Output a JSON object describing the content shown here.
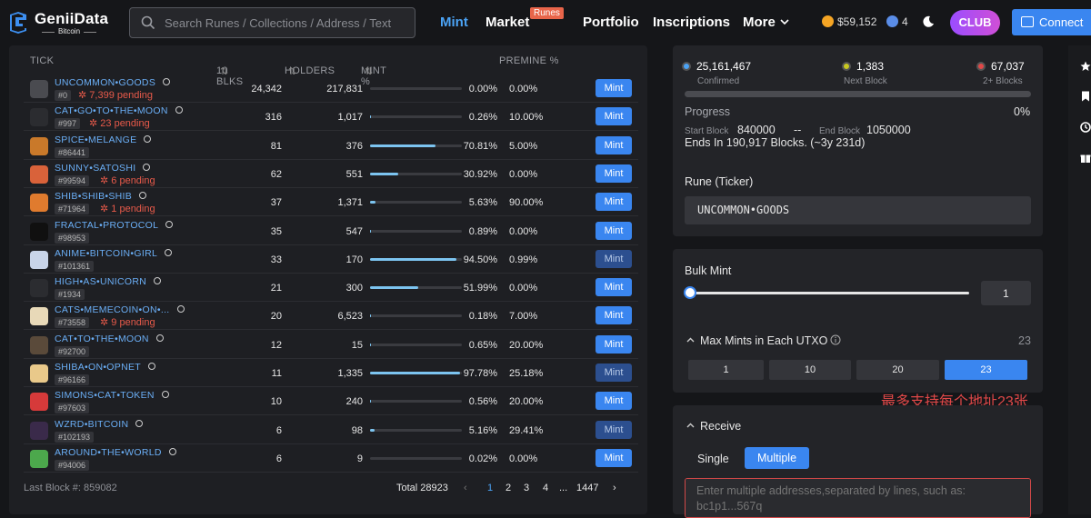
{
  "brand": {
    "name": "GeniiData",
    "subtitle": "Bitcoin"
  },
  "search": {
    "placeholder": "Search Runes / Collections / Address / Text"
  },
  "nav": {
    "mint": "Mint",
    "market": "Market",
    "market_badge": "Runes",
    "portfolio": "Portfolio",
    "inscriptions": "Inscriptions",
    "more": "More"
  },
  "header": {
    "btc_price": "$59,152",
    "gas": "4",
    "club": "CLUB",
    "connect": "Connect"
  },
  "table": {
    "headers": {
      "tick": "TICK",
      "blks": "10 BLKS",
      "holders": "HOLDERS",
      "mint": "MINT %",
      "premine": "PREMINE %"
    },
    "mint_label": "Mint",
    "rows": [
      {
        "tick": "UNCOMMON•GOODS",
        "num": "#0",
        "pending": "7,399 pending",
        "blks": "24,342",
        "holders": "217,831",
        "mint_pct": "0.00%",
        "progress": 0.0,
        "premine": "0.00%",
        "icon_color": "#4a4b50",
        "dim": false
      },
      {
        "tick": "CAT•GO•TO•THE•MOON",
        "num": "#997",
        "pending": "23 pending",
        "blks": "316",
        "holders": "1,017",
        "mint_pct": "0.26%",
        "progress": 0.26,
        "premine": "10.00%",
        "icon_color": "#2b2c30",
        "dim": false
      },
      {
        "tick": "SPICE•MELANGE",
        "num": "#86441",
        "pending": "",
        "blks": "81",
        "holders": "376",
        "mint_pct": "70.81%",
        "progress": 70.81,
        "premine": "5.00%",
        "icon_color": "#c9792a",
        "dim": false
      },
      {
        "tick": "SUNNY•SATOSHI",
        "num": "#99594",
        "pending": "6 pending",
        "blks": "62",
        "holders": "551",
        "mint_pct": "30.92%",
        "progress": 30.92,
        "premine": "0.00%",
        "icon_color": "#d9623a",
        "dim": false
      },
      {
        "tick": "SHIB•SHIB•SHIB",
        "num": "#71964",
        "pending": "1 pending",
        "blks": "37",
        "holders": "1,371",
        "mint_pct": "5.63%",
        "progress": 5.63,
        "premine": "90.00%",
        "icon_color": "#e07b2e",
        "dim": false
      },
      {
        "tick": "FRACTAL•PROTOCOL",
        "num": "#98953",
        "pending": "",
        "blks": "35",
        "holders": "547",
        "mint_pct": "0.89%",
        "progress": 0.89,
        "premine": "0.00%",
        "icon_color": "#101010",
        "dim": false
      },
      {
        "tick": "ANIME•BITCOIN•GIRL",
        "num": "#101361",
        "pending": "",
        "blks": "33",
        "holders": "170",
        "mint_pct": "94.50%",
        "progress": 94.5,
        "premine": "0.99%",
        "icon_color": "#c8d4e8",
        "dim": true
      },
      {
        "tick": "HIGH•AS•UNICORN",
        "num": "#1934",
        "pending": "",
        "blks": "21",
        "holders": "300",
        "mint_pct": "51.99%",
        "progress": 51.99,
        "premine": "0.00%",
        "icon_color": "#2b2c30",
        "dim": false
      },
      {
        "tick": "CATS•MEMECOIN•ON•...",
        "num": "#73558",
        "pending": "9 pending",
        "blks": "20",
        "holders": "6,523",
        "mint_pct": "0.18%",
        "progress": 0.18,
        "premine": "7.00%",
        "icon_color": "#e8d9b8",
        "dim": false
      },
      {
        "tick": "CAT•TO•THE•MOON",
        "num": "#92700",
        "pending": "",
        "blks": "12",
        "holders": "15",
        "mint_pct": "0.65%",
        "progress": 0.65,
        "premine": "20.00%",
        "icon_color": "#5a4a3a",
        "dim": false
      },
      {
        "tick": "SHIBA•ON•OPNET",
        "num": "#96166",
        "pending": "",
        "blks": "11",
        "holders": "1,335",
        "mint_pct": "97.78%",
        "progress": 97.78,
        "premine": "25.18%",
        "icon_color": "#e9c98a",
        "dim": true
      },
      {
        "tick": "SIMONS•CAT•TOKEN",
        "num": "#97603",
        "pending": "",
        "blks": "10",
        "holders": "240",
        "mint_pct": "0.56%",
        "progress": 0.56,
        "premine": "20.00%",
        "icon_color": "#d63a3a",
        "dim": false
      },
      {
        "tick": "WZRD•BITCOIN",
        "num": "#102193",
        "pending": "",
        "blks": "6",
        "holders": "98",
        "mint_pct": "5.16%",
        "progress": 5.16,
        "premine": "29.41%",
        "icon_color": "#3a2a4a",
        "dim": true
      },
      {
        "tick": "AROUND•THE•WORLD",
        "num": "#94006",
        "pending": "",
        "blks": "6",
        "holders": "9",
        "mint_pct": "0.02%",
        "progress": 0.02,
        "premine": "0.00%",
        "icon_color": "#4ca84c",
        "dim": false
      }
    ]
  },
  "footer": {
    "last_block": "Last Block #: 859082",
    "total": "Total 28923",
    "pages": [
      "1",
      "2",
      "3",
      "4",
      "...",
      "1447"
    ]
  },
  "stats": {
    "confirmed_value": "25,161,467",
    "confirmed_label": "Confirmed",
    "next_value": "1,383",
    "next_label": "Next Block",
    "blocks_value": "67,037",
    "blocks_label": "2+ Blocks"
  },
  "progress": {
    "label": "Progress",
    "pct": "0%",
    "start_label": "Start Block",
    "start_value": "840000",
    "sep": "--",
    "end_label": "End Block",
    "end_value": "1050000",
    "ends_in": "Ends In 190,917 Blocks. (~3y 231d)"
  },
  "rune": {
    "label": "Rune (Ticker)",
    "value": "UNCOMMON•GOODS"
  },
  "bulk": {
    "label": "Bulk Mint",
    "value": "1",
    "slider": 0
  },
  "max_mints": {
    "label": "Max Mints in Each UTXO",
    "current": "23",
    "options": [
      "1",
      "10",
      "20",
      "23"
    ],
    "selected": 3
  },
  "note_cn": "最多支持每个地址23张",
  "receive": {
    "label": "Receive",
    "single": "Single",
    "multiple": "Multiple",
    "placeholder": "Enter multiple addresses,separated by lines, such as:\nbc1p1...567q"
  },
  "colors": {
    "accent": "#3a86f0",
    "link": "#6aaef5",
    "pending": "#e85a4a",
    "confirmed": "#4ba3f5",
    "next": "#c8c820",
    "blocks": "#e04848"
  }
}
